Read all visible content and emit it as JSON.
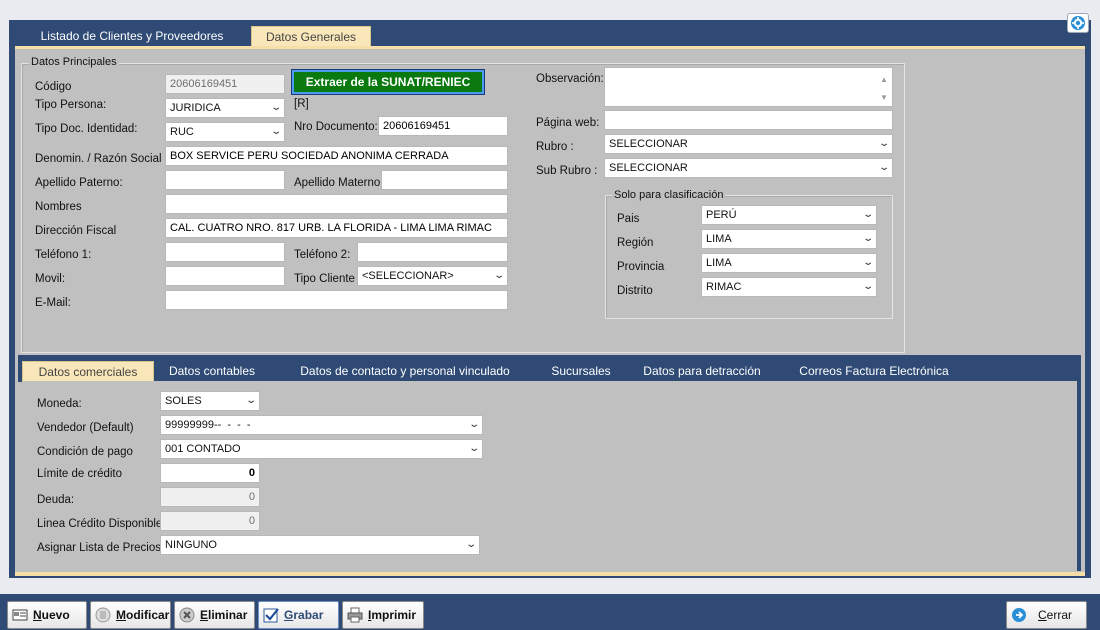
{
  "top_tabs": [
    {
      "label": "Listado de Clientes y Proveedores"
    },
    {
      "label": "Datos Generales"
    }
  ],
  "principales": {
    "legend": "Datos Principales",
    "codigo": {
      "label": "Código",
      "value": "20606169451"
    },
    "sunat_button": "Extraer de la SUNAT/RENIEC",
    "tipo_persona": {
      "label": "Tipo Persona:",
      "value": "JURIDICA",
      "tag": "[R]"
    },
    "tipo_doc": {
      "label": "Tipo Doc. Identidad:",
      "value": "RUC"
    },
    "nro_documento": {
      "label": "Nro Documento:",
      "value": "20606169451"
    },
    "razon_social": {
      "label": "Denomin. / Razón Social",
      "value": "BOX SERVICE PERU SOCIEDAD ANONIMA CERRADA"
    },
    "apellido_paterno": {
      "label": "Apellido Paterno:",
      "value": ""
    },
    "apellido_materno": {
      "label": "Apellido Materno:",
      "value": ""
    },
    "nombres": {
      "label": "Nombres",
      "value": ""
    },
    "direccion": {
      "label": "Dirección Fiscal",
      "value": "CAL. CUATRO NRO. 817 URB. LA FLORIDA - LIMA LIMA RIMAC"
    },
    "telefono1": {
      "label": "Teléfono 1:",
      "value": ""
    },
    "telefono2": {
      "label": "Teléfono 2:",
      "value": ""
    },
    "movil": {
      "label": "Movil:",
      "value": ""
    },
    "tipo_cliente": {
      "label": "Tipo Cliente",
      "value": "<SELECCIONAR>"
    },
    "email": {
      "label": "E-Mail:",
      "value": ""
    },
    "observacion": {
      "label": "Observación:",
      "value": ""
    },
    "pagina_web": {
      "label": "Página web:",
      "value": ""
    },
    "rubro": {
      "label": "Rubro :",
      "value": "SELECCIONAR"
    },
    "sub_rubro": {
      "label": "Sub Rubro :",
      "value": "SELECCIONAR"
    }
  },
  "clasificacion": {
    "legend": "Solo para clasificación",
    "pais": {
      "label": "Pais",
      "value": "PERÚ"
    },
    "region": {
      "label": "Región",
      "value": "LIMA"
    },
    "provincia": {
      "label": "Provincia",
      "value": "LIMA"
    },
    "distrito": {
      "label": "Distrito",
      "value": "RIMAC"
    }
  },
  "sub_tabs": [
    {
      "label": "Datos comerciales"
    },
    {
      "label": "Datos contables"
    },
    {
      "label": "Datos de contacto y personal vinculado"
    },
    {
      "label": "Sucursales"
    },
    {
      "label": "Datos para detracción"
    },
    {
      "label": "Correos Factura Electrónica"
    }
  ],
  "comerciales": {
    "moneda": {
      "label": "Moneda:",
      "value": "SOLES"
    },
    "vendedor": {
      "label": "Vendedor (Default)",
      "value": "99999999--  -  -  -"
    },
    "condicion_pago": {
      "label": "Condición de pago",
      "value": "001 CONTADO"
    },
    "limite_credito": {
      "label": "Límite de crédito",
      "value": "0"
    },
    "deuda": {
      "label": "Deuda:",
      "value": "0"
    },
    "linea_credito": {
      "label": "Linea Crédito Disponible",
      "value": "0"
    },
    "lista_precios": {
      "label": "Asignar Lista de Precios",
      "value": "NINGUNO"
    }
  },
  "toolbar": {
    "nuevo": {
      "initial": "N",
      "rest": "uevo"
    },
    "modificar": {
      "initial": "M",
      "rest": "odificar"
    },
    "eliminar": {
      "initial": "E",
      "rest": "liminar"
    },
    "grabar": {
      "initial": "G",
      "rest": "rabar"
    },
    "imprimir": {
      "initial": "I",
      "rest": "mprimir"
    },
    "cerrar": {
      "initial": "C",
      "rest": "errar"
    }
  },
  "colors": {
    "frame": "#2e4a75",
    "panel": "#c0c0c0",
    "active_tab": "#f9e7b9",
    "sunat_button": "#0a7a10"
  },
  "icons": [
    "settings-icon",
    "new-doc-icon",
    "edit-icon",
    "delete-icon",
    "save-check-icon",
    "printer-icon",
    "close-door-icon",
    "scroll-up-icon",
    "scroll-down-icon",
    "chevron-down-icon"
  ]
}
